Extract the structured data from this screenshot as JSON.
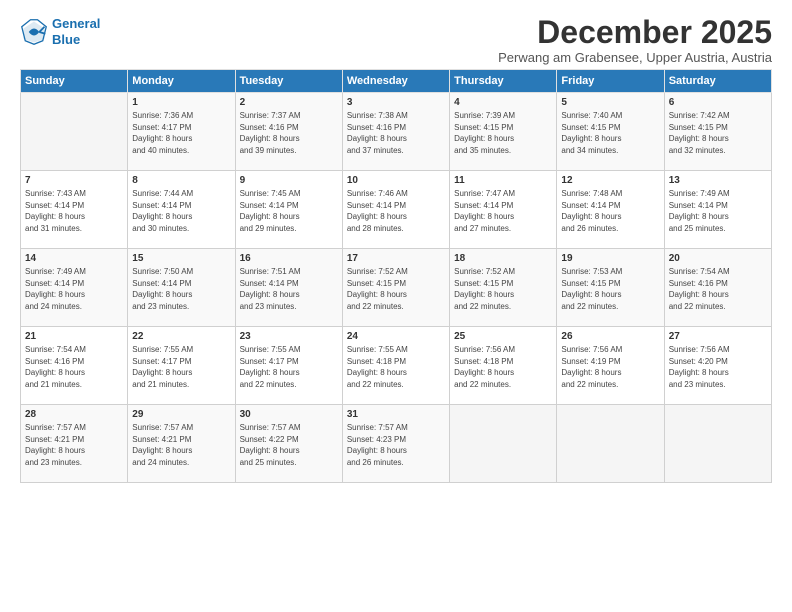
{
  "logo": {
    "line1": "General",
    "line2": "Blue"
  },
  "title": "December 2025",
  "subtitle": "Perwang am Grabensee, Upper Austria, Austria",
  "headers": [
    "Sunday",
    "Monday",
    "Tuesday",
    "Wednesday",
    "Thursday",
    "Friday",
    "Saturday"
  ],
  "weeks": [
    [
      {
        "day": "",
        "info": ""
      },
      {
        "day": "1",
        "info": "Sunrise: 7:36 AM\nSunset: 4:17 PM\nDaylight: 8 hours\nand 40 minutes."
      },
      {
        "day": "2",
        "info": "Sunrise: 7:37 AM\nSunset: 4:16 PM\nDaylight: 8 hours\nand 39 minutes."
      },
      {
        "day": "3",
        "info": "Sunrise: 7:38 AM\nSunset: 4:16 PM\nDaylight: 8 hours\nand 37 minutes."
      },
      {
        "day": "4",
        "info": "Sunrise: 7:39 AM\nSunset: 4:15 PM\nDaylight: 8 hours\nand 35 minutes."
      },
      {
        "day": "5",
        "info": "Sunrise: 7:40 AM\nSunset: 4:15 PM\nDaylight: 8 hours\nand 34 minutes."
      },
      {
        "day": "6",
        "info": "Sunrise: 7:42 AM\nSunset: 4:15 PM\nDaylight: 8 hours\nand 32 minutes."
      }
    ],
    [
      {
        "day": "7",
        "info": "Sunrise: 7:43 AM\nSunset: 4:14 PM\nDaylight: 8 hours\nand 31 minutes."
      },
      {
        "day": "8",
        "info": "Sunrise: 7:44 AM\nSunset: 4:14 PM\nDaylight: 8 hours\nand 30 minutes."
      },
      {
        "day": "9",
        "info": "Sunrise: 7:45 AM\nSunset: 4:14 PM\nDaylight: 8 hours\nand 29 minutes."
      },
      {
        "day": "10",
        "info": "Sunrise: 7:46 AM\nSunset: 4:14 PM\nDaylight: 8 hours\nand 28 minutes."
      },
      {
        "day": "11",
        "info": "Sunrise: 7:47 AM\nSunset: 4:14 PM\nDaylight: 8 hours\nand 27 minutes."
      },
      {
        "day": "12",
        "info": "Sunrise: 7:48 AM\nSunset: 4:14 PM\nDaylight: 8 hours\nand 26 minutes."
      },
      {
        "day": "13",
        "info": "Sunrise: 7:49 AM\nSunset: 4:14 PM\nDaylight: 8 hours\nand 25 minutes."
      }
    ],
    [
      {
        "day": "14",
        "info": "Sunrise: 7:49 AM\nSunset: 4:14 PM\nDaylight: 8 hours\nand 24 minutes."
      },
      {
        "day": "15",
        "info": "Sunrise: 7:50 AM\nSunset: 4:14 PM\nDaylight: 8 hours\nand 23 minutes."
      },
      {
        "day": "16",
        "info": "Sunrise: 7:51 AM\nSunset: 4:14 PM\nDaylight: 8 hours\nand 23 minutes."
      },
      {
        "day": "17",
        "info": "Sunrise: 7:52 AM\nSunset: 4:15 PM\nDaylight: 8 hours\nand 22 minutes."
      },
      {
        "day": "18",
        "info": "Sunrise: 7:52 AM\nSunset: 4:15 PM\nDaylight: 8 hours\nand 22 minutes."
      },
      {
        "day": "19",
        "info": "Sunrise: 7:53 AM\nSunset: 4:15 PM\nDaylight: 8 hours\nand 22 minutes."
      },
      {
        "day": "20",
        "info": "Sunrise: 7:54 AM\nSunset: 4:16 PM\nDaylight: 8 hours\nand 22 minutes."
      }
    ],
    [
      {
        "day": "21",
        "info": "Sunrise: 7:54 AM\nSunset: 4:16 PM\nDaylight: 8 hours\nand 21 minutes."
      },
      {
        "day": "22",
        "info": "Sunrise: 7:55 AM\nSunset: 4:17 PM\nDaylight: 8 hours\nand 21 minutes."
      },
      {
        "day": "23",
        "info": "Sunrise: 7:55 AM\nSunset: 4:17 PM\nDaylight: 8 hours\nand 22 minutes."
      },
      {
        "day": "24",
        "info": "Sunrise: 7:55 AM\nSunset: 4:18 PM\nDaylight: 8 hours\nand 22 minutes."
      },
      {
        "day": "25",
        "info": "Sunrise: 7:56 AM\nSunset: 4:18 PM\nDaylight: 8 hours\nand 22 minutes."
      },
      {
        "day": "26",
        "info": "Sunrise: 7:56 AM\nSunset: 4:19 PM\nDaylight: 8 hours\nand 22 minutes."
      },
      {
        "day": "27",
        "info": "Sunrise: 7:56 AM\nSunset: 4:20 PM\nDaylight: 8 hours\nand 23 minutes."
      }
    ],
    [
      {
        "day": "28",
        "info": "Sunrise: 7:57 AM\nSunset: 4:21 PM\nDaylight: 8 hours\nand 23 minutes."
      },
      {
        "day": "29",
        "info": "Sunrise: 7:57 AM\nSunset: 4:21 PM\nDaylight: 8 hours\nand 24 minutes."
      },
      {
        "day": "30",
        "info": "Sunrise: 7:57 AM\nSunset: 4:22 PM\nDaylight: 8 hours\nand 25 minutes."
      },
      {
        "day": "31",
        "info": "Sunrise: 7:57 AM\nSunset: 4:23 PM\nDaylight: 8 hours\nand 26 minutes."
      },
      {
        "day": "",
        "info": ""
      },
      {
        "day": "",
        "info": ""
      },
      {
        "day": "",
        "info": ""
      }
    ]
  ]
}
